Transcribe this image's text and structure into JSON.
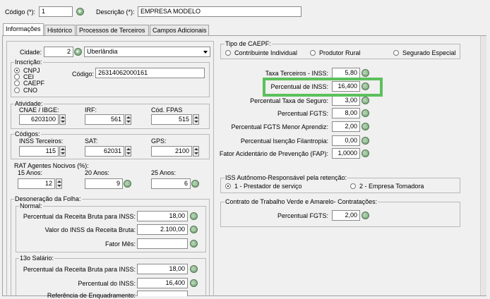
{
  "header": {
    "codigo_label": "Código (*):",
    "codigo_value": "1",
    "descricao_label": "Descrição (*):",
    "descricao_value": "EMPRESA MODELO"
  },
  "tabs": [
    {
      "label": "Informações"
    },
    {
      "label": "Histórico"
    },
    {
      "label": "Processos de Terceiros"
    },
    {
      "label": "Campos Adicionais"
    }
  ],
  "cidade": {
    "label": "Cidade:",
    "code": "2",
    "name": "Uberlândia"
  },
  "inscricao": {
    "title": "Inscrição:",
    "options": [
      "CNPJ",
      "CEI",
      "CAEPF",
      "CNO"
    ],
    "codigo_label": "Código:",
    "codigo_value": "26314062000161"
  },
  "atividade": {
    "title": "Atividade:",
    "cnae_label": "CNAE / IBGE:",
    "cnae_value": "6203100",
    "irf_label": "IRF:",
    "irf_value": "561",
    "fpas_label": "Cód. FPAS",
    "fpas_value": "515"
  },
  "codigos": {
    "title": "Códigos:",
    "inss_label": "INSS Terceiros:",
    "inss_value": "115",
    "sat_label": "SAT:",
    "sat_value": "62031",
    "gps_label": "GPS:",
    "gps_value": "2100"
  },
  "rat": {
    "title": "RAT Agentes Nocivos (%):",
    "a15_label": "15 Anos:",
    "a15_value": "12",
    "a20_label": "20 Anos:",
    "a20_value": "9",
    "a25_label": "25 Anos:",
    "a25_value": "6"
  },
  "desoneracao": {
    "title": "Desoneração da Folha:",
    "normal_title": "Normal:",
    "pct_receita_label": "Percentual da Receita Bruta para INSS:",
    "pct_receita_value": "18,00",
    "valor_inss_label": "Valor do INSS da Receita Bruta:",
    "valor_inss_value": "2.100,00",
    "fator_label": "Fator Mês:",
    "fator_value": "",
    "decimo_title": "13o Salário:",
    "d_pct_receita_label": "Percentual da Receita Bruta para INSS:",
    "d_pct_receita_value": "18,00",
    "d_pct_inss_label": "Percentual do INSS:",
    "d_pct_inss_value": "16,400",
    "d_ref_label": "Referência de Enquadramento:"
  },
  "caepf": {
    "title": "Tipo de CAEPF:",
    "options": [
      "Contribuinte Individual",
      "Produtor Rural",
      "Segurado Especial"
    ]
  },
  "percentuais": {
    "taxa_terceiros_label": "Taxa Terceiros - INSS:",
    "taxa_terceiros_value": "5,80",
    "pct_inss_label": "Percentual de INSS:",
    "pct_inss_value": "16,400",
    "taxa_seguro_label": "Percentual Taxa de Seguro:",
    "taxa_seguro_value": "3,00",
    "fgts_label": "Percentual FGTS:",
    "fgts_value": "8,00",
    "fgts_menor_label": "Percentual FGTS Menor Aprendiz:",
    "fgts_menor_value": "2,00",
    "isencao_label": "Percentual Isenção Filantropia:",
    "isencao_value": "0,00",
    "fap_label": "Fator Acidentário de Prevenção (FAP):",
    "fap_value": "1,0000"
  },
  "iss": {
    "title": "ISS Autônomo-Responsável pela retenção:",
    "options": [
      "1 - Prestador de serviço",
      "2 - Empresa Tomadora"
    ]
  },
  "contrato": {
    "title": "Contrato de Trabalho Verde e Amarelo- Contratações:",
    "fgts_label": "Percentual FGTS:",
    "fgts_value": "2,00"
  },
  "colors": {
    "highlight": "#5cc05c"
  }
}
